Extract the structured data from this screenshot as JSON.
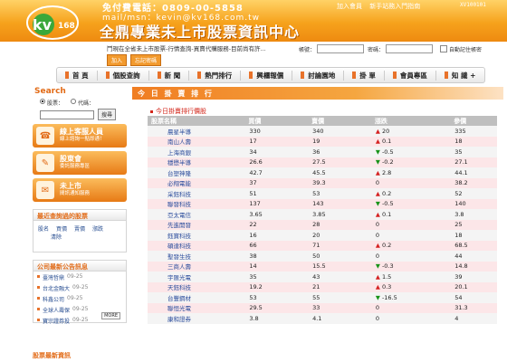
{
  "header": {
    "phone": "免付費電話：0809-00-5858",
    "mail": "mail/msn：kevin@kv168.com.tw",
    "slogan": "全鼎專業未上市股票資訊中心",
    "top_links": [
      "加入會員",
      "新手站務入門指南"
    ],
    "code": "XV100101"
  },
  "ticker": "鬥現在全省未上市股票-行情查詢-買賣代購服務-目前尚有許...",
  "login": {
    "account_label": "帳號：",
    "password_label": "密碼：",
    "remember_label": "自動記住帳密",
    "join_label": "加入",
    "forgot_label": "忘記密碼"
  },
  "nav": [
    "首 頁",
    "個股查詢",
    "新 聞",
    "熱門排行",
    "興櫃報價",
    "討論園地",
    "掛 單",
    "會員專區",
    "知 識 +"
  ],
  "sidebar": {
    "search_title": "Search",
    "radio_code": "股票：",
    "radio_name": "代碼：",
    "search_button": "搜尋",
    "promos": [
      {
        "title": "線上客服人員",
        "sub": "線上諮詢一點即通！"
      },
      {
        "title": "股東會",
        "sub": "委託服務專區"
      },
      {
        "title": "未上市",
        "sub": "間訊通知服務"
      }
    ],
    "recent_title": "最近查詢過的股票",
    "recent_links": [
      "股名",
      "買價",
      "賣價",
      "漲跌",
      "清除"
    ],
    "news_title": "公司最新公告訊息",
    "news": [
      {
        "name": "臺灣哲鼎",
        "date": "09-25"
      },
      {
        "name": "台北金融大",
        "date": "09-25"
      },
      {
        "name": "科鑫公司",
        "date": "09-25"
      },
      {
        "name": "全球人壽保",
        "date": "09-25"
      },
      {
        "name": "寶宗證券投",
        "date": "09-25"
      }
    ],
    "more": "MORE",
    "bottom_title": "股票最新資訊"
  },
  "main": {
    "section_title": "今 日 掛 賣 排 行",
    "subtitle": "今日掛賣排行價股",
    "columns": [
      "股票名稱",
      "買價",
      "賣價",
      "漲跌",
      "參價"
    ],
    "rows": [
      {
        "name": "晨星半導",
        "buy": "330",
        "sell": "340",
        "dir": "up",
        "chg": "20",
        "ref": "335"
      },
      {
        "name": "南山人壽",
        "buy": "17",
        "sell": "19",
        "dir": "up",
        "chg": "0.1",
        "ref": "18"
      },
      {
        "name": "上海商銀",
        "buy": "34",
        "sell": "36",
        "dir": "dn",
        "chg": "-0.5",
        "ref": "35"
      },
      {
        "name": "穩懋半導",
        "buy": "26.6",
        "sell": "27.5",
        "dir": "dn",
        "chg": "-0.2",
        "ref": "27.1"
      },
      {
        "name": "台塑神隆",
        "buy": "42.7",
        "sell": "45.5",
        "dir": "up",
        "chg": "2.8",
        "ref": "44.1"
      },
      {
        "name": "必翔電能",
        "buy": "37",
        "sell": "39.3",
        "dir": "",
        "chg": "0",
        "ref": "38.2"
      },
      {
        "name": "采鈺科技",
        "buy": "51",
        "sell": "53",
        "dir": "up",
        "chg": "0.2",
        "ref": "52"
      },
      {
        "name": "聯發科技",
        "buy": "137",
        "sell": "143",
        "dir": "dn",
        "chg": "-0.5",
        "ref": "140"
      },
      {
        "name": "亞太電信",
        "buy": "3.65",
        "sell": "3.85",
        "dir": "up",
        "chg": "0.1",
        "ref": "3.8"
      },
      {
        "name": "先進開發",
        "buy": "22",
        "sell": "28",
        "dir": "",
        "chg": "0",
        "ref": "25"
      },
      {
        "name": "鈺寶科技",
        "buy": "16",
        "sell": "20",
        "dir": "",
        "chg": "0",
        "ref": "18"
      },
      {
        "name": "碩達科技",
        "buy": "66",
        "sell": "71",
        "dir": "up",
        "chg": "0.2",
        "ref": "68.5"
      },
      {
        "name": "聖發生技",
        "buy": "38",
        "sell": "50",
        "dir": "",
        "chg": "0",
        "ref": "44"
      },
      {
        "name": "三商人壽",
        "buy": "14",
        "sell": "15.5",
        "dir": "dn",
        "chg": "-0.3",
        "ref": "14.8"
      },
      {
        "name": "宇匯光電",
        "buy": "35",
        "sell": "43",
        "dir": "up",
        "chg": "1.5",
        "ref": "39"
      },
      {
        "name": "天鈺科技",
        "buy": "19.2",
        "sell": "21",
        "dir": "up",
        "chg": "0.3",
        "ref": "20.1"
      },
      {
        "name": "台豐鋼材",
        "buy": "53",
        "sell": "55",
        "dir": "dn",
        "chg": "-16.5",
        "ref": "54"
      },
      {
        "name": "聯恒光電",
        "buy": "29.5",
        "sell": "33",
        "dir": "",
        "chg": "0",
        "ref": "31.3"
      },
      {
        "name": "康和證券",
        "buy": "3.8",
        "sell": "4.1",
        "dir": "",
        "chg": "0",
        "ref": "4"
      }
    ]
  }
}
